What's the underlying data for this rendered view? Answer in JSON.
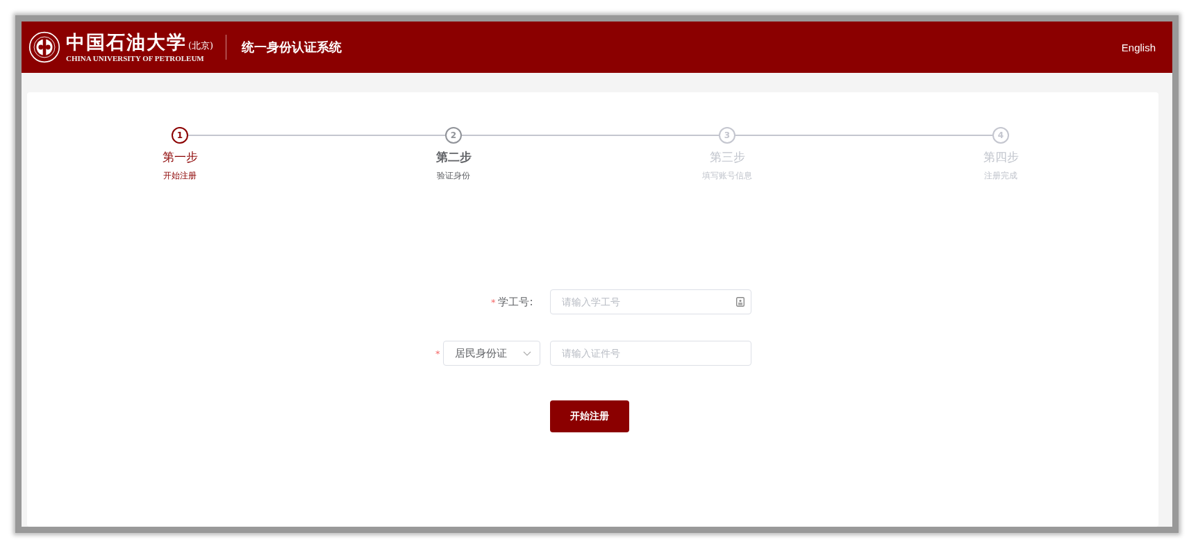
{
  "header": {
    "logo": {
      "name": "中国石油大学",
      "campus": "(北京)",
      "english": "CHINA UNIVERSITY OF PETROLEUM"
    },
    "system_title": "统一身份认证系统",
    "language_link": "English"
  },
  "steps": [
    {
      "number": "1",
      "title": "第一步",
      "subtitle": "开始注册",
      "selected": true,
      "highlighted": false
    },
    {
      "number": "2",
      "title": "第二步",
      "subtitle": "验证身份",
      "selected": false,
      "highlighted": true
    },
    {
      "number": "3",
      "title": "第三步",
      "subtitle": "填写账号信息",
      "selected": false,
      "highlighted": false
    },
    {
      "number": "4",
      "title": "第四步",
      "subtitle": "注册完成",
      "selected": false,
      "highlighted": false
    }
  ],
  "form": {
    "student_id": {
      "required_mark": "*",
      "label": "学工号:",
      "placeholder": "请输入学工号"
    },
    "id_document": {
      "required_mark": "*",
      "type": "居民身份证",
      "placeholder": "请输入证件号"
    },
    "submit": "开始注册"
  }
}
